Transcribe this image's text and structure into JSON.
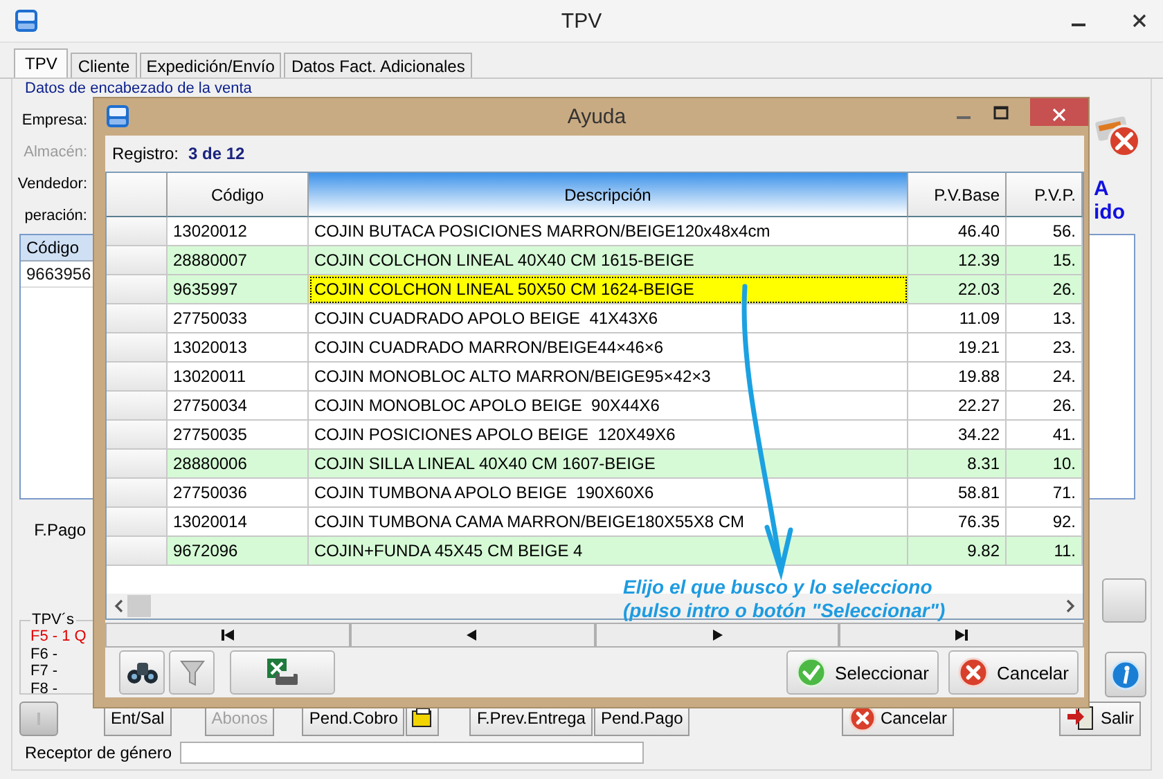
{
  "window": {
    "title": "TPV"
  },
  "tabs": [
    {
      "label": "TPV",
      "selected": true
    },
    {
      "label": "Cliente",
      "selected": false
    },
    {
      "label": "Expedición/Envío",
      "selected": false
    },
    {
      "label": "Datos Fact. Adicionales",
      "selected": false
    }
  ],
  "header_section": {
    "title": "Datos de encabezado de la venta"
  },
  "form_labels": [
    {
      "label": "Empresa:",
      "disabled": false
    },
    {
      "label": "Almacén:",
      "disabled": true
    },
    {
      "label": "Vendedor:",
      "disabled": false
    },
    {
      "label": "peración:",
      "disabled": false
    }
  ],
  "side_texts": [
    "A",
    "ido"
  ],
  "lines_table": {
    "columns": [
      "Código"
    ],
    "rows": [
      "9663956"
    ]
  },
  "payment_label": "F.Pago",
  "tpv_group": {
    "title": "TPV´s",
    "items": [
      {
        "label": "F5 - 1 Q",
        "active": true
      },
      {
        "label": "F6 -",
        "active": false
      },
      {
        "label": "F7 -",
        "active": false
      },
      {
        "label": "F8 -",
        "active": false
      }
    ]
  },
  "bottom_buttons": [
    {
      "kind": "blank"
    },
    {
      "kind": "text",
      "label": "Ent/Sal",
      "disabled": false
    },
    {
      "kind": "text",
      "label": "Abonos",
      "disabled": true
    },
    {
      "kind": "text",
      "label": "Pend.Cobro",
      "disabled": false
    },
    {
      "kind": "icon"
    },
    {
      "kind": "text",
      "label": "F.Prev.Entrega",
      "disabled": false
    },
    {
      "kind": "text",
      "label": "Pend.Pago",
      "disabled": false
    },
    {
      "kind": "cancel",
      "label": "Cancelar",
      "disabled": false
    },
    {
      "kind": "exit",
      "label": "Salir",
      "disabled": false
    }
  ],
  "receiver": {
    "label": "Receptor de género"
  },
  "dialog": {
    "title": "Ayuda",
    "record_label": "Registro:",
    "record_value": "3 de 12",
    "columns": [
      {
        "label": "Código",
        "sorted": false
      },
      {
        "label": "Descripción",
        "sorted": true
      },
      {
        "label": "P.V.Base",
        "sorted": false
      },
      {
        "label": "P.V.P.",
        "sorted": false
      }
    ],
    "rows": [
      {
        "code": "13020012",
        "description": "COJIN BUTACA POSICIONES MARRON/BEIGE120x48x4cm",
        "base_price": "46.40",
        "retail_price": "56.",
        "highlighted": false,
        "selected": false
      },
      {
        "code": "28880007",
        "description": "COJIN COLCHON LINEAL 40X40 CM 1615-BEIGE",
        "base_price": "12.39",
        "retail_price": "15.",
        "highlighted": true,
        "selected": false
      },
      {
        "code": "9635997",
        "description": "COJIN COLCHON LINEAL 50X50 CM 1624-BEIGE",
        "base_price": "22.03",
        "retail_price": "26.",
        "highlighted": true,
        "selected": true
      },
      {
        "code": "27750033",
        "description": "COJIN CUADRADO APOLO BEIGE  41X43X6",
        "base_price": "11.09",
        "retail_price": "13.",
        "highlighted": false,
        "selected": false
      },
      {
        "code": "13020013",
        "description": "COJIN CUADRADO MARRON/BEIGE44×46×6",
        "base_price": "19.21",
        "retail_price": "23.",
        "highlighted": false,
        "selected": false
      },
      {
        "code": "13020011",
        "description": "COJIN MONOBLOC ALTO MARRON/BEIGE95×42×3",
        "base_price": "19.88",
        "retail_price": "24.",
        "highlighted": false,
        "selected": false
      },
      {
        "code": "27750034",
        "description": "COJIN MONOBLOC APOLO BEIGE  90X44X6",
        "base_price": "22.27",
        "retail_price": "26.",
        "highlighted": false,
        "selected": false
      },
      {
        "code": "27750035",
        "description": "COJIN POSICIONES APOLO BEIGE  120X49X6",
        "base_price": "34.22",
        "retail_price": "41.",
        "highlighted": false,
        "selected": false
      },
      {
        "code": "28880006",
        "description": "COJIN SILLA LINEAL 40X40 CM 1607-BEIGE",
        "base_price": "8.31",
        "retail_price": "10.",
        "highlighted": true,
        "selected": false
      },
      {
        "code": "27750036",
        "description": "COJIN TUMBONA APOLO BEIGE  190X60X6",
        "base_price": "58.81",
        "retail_price": "71.",
        "highlighted": false,
        "selected": false
      },
      {
        "code": "13020014",
        "description": "COJIN TUMBONA CAMA MARRON/BEIGE180X55X8 CM",
        "base_price": "76.35",
        "retail_price": "92.",
        "highlighted": false,
        "selected": false
      },
      {
        "code": "9672096",
        "description": "COJIN+FUNDA 45X45 CM BEIGE 4",
        "base_price": "9.82",
        "retail_price": "11.",
        "highlighted": true,
        "selected": false
      }
    ],
    "annotation": [
      "Elijo el que busco y lo selecciono",
      "(pulso intro o botón \"Seleccionar\")"
    ],
    "buttons": [
      {
        "kind": "ok",
        "label": "Seleccionar"
      },
      {
        "kind": "cancel",
        "label": "Cancelar"
      }
    ]
  }
}
